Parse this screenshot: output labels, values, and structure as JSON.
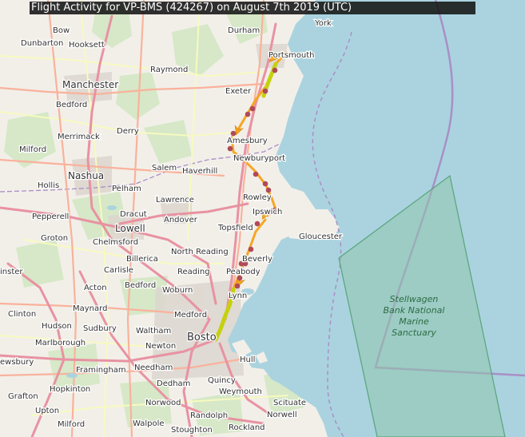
{
  "title": "Flight Activity for VP-BMS (424267) on August 7th 2019 (UTC)",
  "colors": {
    "land": "#f2efe9",
    "water": "#aad3df",
    "forest": "#cfe6c0",
    "urban": "#ddd8d2",
    "motorway": "#e892a2",
    "primary": "#f9b29c",
    "secondary": "#f7fabf",
    "boundary": "#a98fc6",
    "sanctuary_fill": "#8fc7ab",
    "sanctuary_stroke": "#5aa37c",
    "track_orange": "#f5a623",
    "track_green": "#c5d10e",
    "point": "#b04a5a"
  },
  "sanctuary": {
    "lines": [
      "Stellwagen",
      "Bank National",
      "Marine",
      "Sanctuary"
    ]
  },
  "places": [
    {
      "name": "York",
      "kind": "town"
    },
    {
      "name": "Bow",
      "kind": "town"
    },
    {
      "name": "Durham",
      "kind": "town"
    },
    {
      "name": "Dunbarton",
      "kind": "town"
    },
    {
      "name": "Hooksett",
      "kind": "town"
    },
    {
      "name": "Portsmouth",
      "kind": "town"
    },
    {
      "name": "Raymond",
      "kind": "town"
    },
    {
      "name": "Manchester",
      "kind": "city"
    },
    {
      "name": "Exeter",
      "kind": "town"
    },
    {
      "name": "Bedford",
      "kind": "town"
    },
    {
      "name": "Derry",
      "kind": "town"
    },
    {
      "name": "Merrimack",
      "kind": "town"
    },
    {
      "name": "Amesbury",
      "kind": "town"
    },
    {
      "name": "Milford",
      "kind": "town"
    },
    {
      "name": "Newburyport",
      "kind": "town"
    },
    {
      "name": "Nashua",
      "kind": "city"
    },
    {
      "name": "Salem",
      "kind": "town"
    },
    {
      "name": "Haverhill",
      "kind": "town"
    },
    {
      "name": "Hollis",
      "kind": "town"
    },
    {
      "name": "Pelham",
      "kind": "town"
    },
    {
      "name": "Rowley",
      "kind": "town"
    },
    {
      "name": "Dracut",
      "kind": "town"
    },
    {
      "name": "Lawrence",
      "kind": "town"
    },
    {
      "name": "Ipswich",
      "kind": "town"
    },
    {
      "name": "Pepperell",
      "kind": "town"
    },
    {
      "name": "Andover",
      "kind": "town"
    },
    {
      "name": "Lowell",
      "kind": "city"
    },
    {
      "name": "Groton",
      "kind": "town"
    },
    {
      "name": "Chelmsford",
      "kind": "town"
    },
    {
      "name": "Topsfield",
      "kind": "town"
    },
    {
      "name": "Gloucester",
      "kind": "town"
    },
    {
      "name": "North Reading",
      "kind": "town"
    },
    {
      "name": "Billerica",
      "kind": "town"
    },
    {
      "name": "Beverly",
      "kind": "town"
    },
    {
      "name": "Carlisle",
      "kind": "town"
    },
    {
      "name": "Reading",
      "kind": "town"
    },
    {
      "name": "Peabody",
      "kind": "town"
    },
    {
      "name": "inster",
      "kind": "town"
    },
    {
      "name": "Bedford",
      "kind": "town"
    },
    {
      "name": "Acton",
      "kind": "town"
    },
    {
      "name": "Woburn",
      "kind": "town"
    },
    {
      "name": "Lynn",
      "kind": "town"
    },
    {
      "name": "Maynard",
      "kind": "town"
    },
    {
      "name": "Clinton",
      "kind": "town"
    },
    {
      "name": "Medford",
      "kind": "town"
    },
    {
      "name": "Hudson",
      "kind": "town"
    },
    {
      "name": "Sudbury",
      "kind": "town"
    },
    {
      "name": "Waltham",
      "kind": "town"
    },
    {
      "name": "Bosto",
      "kind": "big"
    },
    {
      "name": "Marlborough",
      "kind": "town"
    },
    {
      "name": "Newton",
      "kind": "town"
    },
    {
      "name": "Hull",
      "kind": "town"
    },
    {
      "name": "ewsbury",
      "kind": "town"
    },
    {
      "name": "Framingham",
      "kind": "town"
    },
    {
      "name": "Needham",
      "kind": "town"
    },
    {
      "name": "Quincy",
      "kind": "town"
    },
    {
      "name": "Hopkinton",
      "kind": "town"
    },
    {
      "name": "Dedham",
      "kind": "town"
    },
    {
      "name": "Weymouth",
      "kind": "town"
    },
    {
      "name": "Grafton",
      "kind": "town"
    },
    {
      "name": "Norwood",
      "kind": "town"
    },
    {
      "name": "Scituate",
      "kind": "town"
    },
    {
      "name": "Upton",
      "kind": "town"
    },
    {
      "name": "Randolph",
      "kind": "town"
    },
    {
      "name": "Norwell",
      "kind": "town"
    },
    {
      "name": "Milford",
      "kind": "town"
    },
    {
      "name": "Walpole",
      "kind": "town"
    },
    {
      "name": "Stoughton",
      "kind": "town"
    },
    {
      "name": "Rockland",
      "kind": "town"
    }
  ]
}
